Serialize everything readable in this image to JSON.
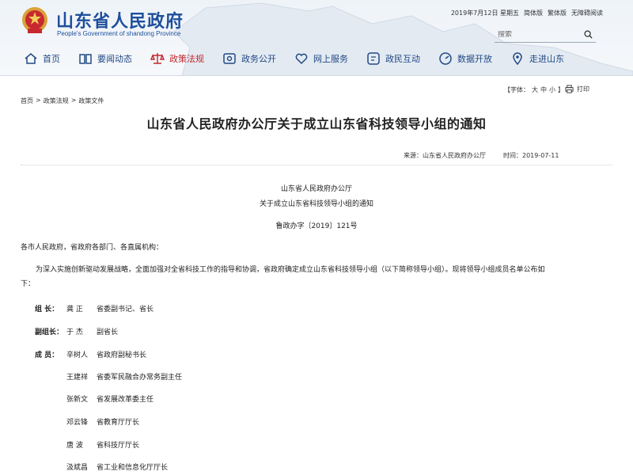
{
  "header": {
    "site_title": "山东省人民政府",
    "site_subtitle": "People's Government of shandong Province",
    "top_links": [
      "2019年7月12日 星期五",
      "简体版",
      "繁体版",
      "无障碍阅读"
    ],
    "search_placeholder": "搜索",
    "nav": [
      {
        "label": "首页",
        "icon": "home-icon",
        "active": false
      },
      {
        "label": "要闻动态",
        "icon": "book-icon",
        "active": false
      },
      {
        "label": "政策法规",
        "icon": "scales-icon",
        "active": true
      },
      {
        "label": "政务公开",
        "icon": "eye-icon",
        "active": false
      },
      {
        "label": "网上服务",
        "icon": "heart-icon",
        "active": false
      },
      {
        "label": "政民互动",
        "icon": "chat-icon",
        "active": false
      },
      {
        "label": "数据开放",
        "icon": "gauge-icon",
        "active": false
      },
      {
        "label": "走进山东",
        "icon": "location-icon",
        "active": false
      }
    ]
  },
  "toolbar": {
    "breadcrumb": [
      "首页",
      "政策法规",
      "政策文件"
    ],
    "font_label_start": "【字体：",
    "font_large": "大",
    "font_medium": "中",
    "font_small": "小",
    "font_label_end": "】",
    "print_label": "打印"
  },
  "article": {
    "title": "山东省人民政府办公厅关于成立山东省科技领导小组的通知",
    "source": "来源：山东省人民政府办公厅",
    "time": "时间：2019-07-11",
    "issuer": "山东省人民政府办公厅",
    "subtitle": "关于成立山东省科技领导小组的通知",
    "doc_number": "鲁政办字〔2019〕121号",
    "recipients": "各市人民政府，省政府各部门、各直属机构：",
    "body_line1": "为深入实施创新驱动发展战略，全面加强对全省科技工作的指导和协调，省政府确定成立山东省科技领导小组（以下简称领导小组）。现将领导小组成员名单公布如",
    "body_line2": "下：",
    "members": [
      {
        "role": "组  长：",
        "name": "龚  正",
        "position": "省委副书记、省长"
      },
      {
        "role": "副组长：",
        "name": "于  杰",
        "position": "副省长"
      },
      {
        "role": "成  员：",
        "name": "辛树人",
        "position": "省政府副秘书长"
      },
      {
        "role": "",
        "name": "王建祥",
        "position": "省委军民融合办常务副主任"
      },
      {
        "role": "",
        "name": "张新文",
        "position": "省发展改革委主任"
      },
      {
        "role": "",
        "name": "邓云锋",
        "position": "省教育厅厅长"
      },
      {
        "role": "",
        "name": "唐  波",
        "position": "省科技厅厅长"
      },
      {
        "role": "",
        "name": "汲斌昌",
        "position": "省工业和信息化厅厅长"
      }
    ]
  },
  "colors": {
    "brand_blue": "#1e4f9c",
    "active_red": "#c0282d"
  }
}
